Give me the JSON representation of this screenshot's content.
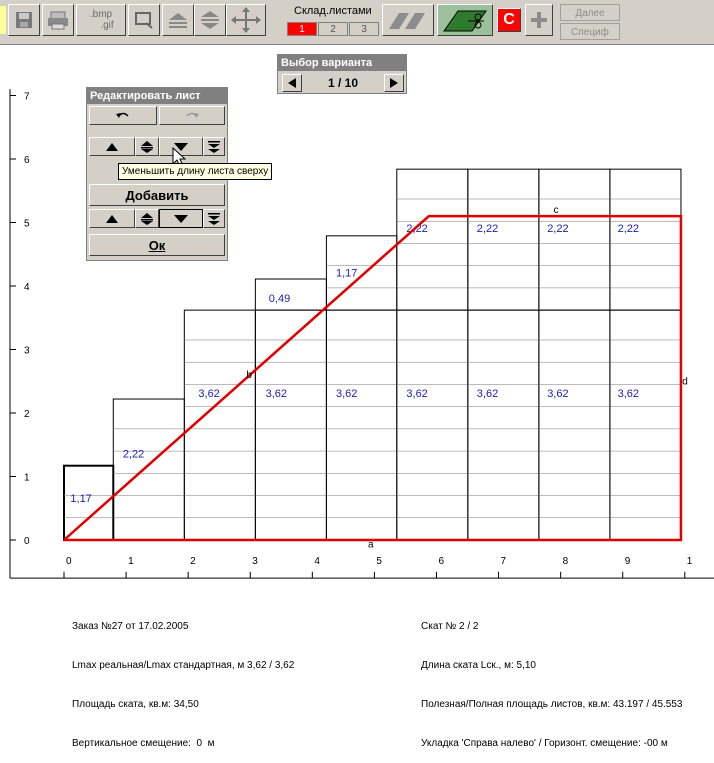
{
  "toolbar": {
    "bmp_label": ".bmp",
    "gif_label": ".gif",
    "sklad_label": "Склад.листами",
    "sklad_tabs": [
      "1",
      "2",
      "3"
    ],
    "c_label": "С",
    "next_label": "Далее",
    "spec_label": "Специф"
  },
  "variant": {
    "title": "Выбор варианта",
    "value": "1 / 10"
  },
  "edit_panel": {
    "title": "Редактировать лист",
    "add_label": "Добавить",
    "ok_label": "Ок"
  },
  "tooltip": "Уменьшить длину листа сверху",
  "chart_data": {
    "type": "roof-sheet-layout",
    "x_ticks": [
      "0",
      "1",
      "2",
      "3",
      "4",
      "5",
      "6",
      "7",
      "8",
      "9",
      "1"
    ],
    "y_ticks": [
      "0",
      "1",
      "2",
      "3",
      "4",
      "5",
      "6",
      "7"
    ],
    "sheet_columns": [
      {
        "x0": 0,
        "x1": 0.77,
        "heights": [
          1.17
        ]
      },
      {
        "x0": 0.77,
        "x1": 1.88,
        "heights": [
          2.22
        ]
      },
      {
        "x0": 1.88,
        "x1": 2.99,
        "heights": [
          3.62
        ]
      },
      {
        "x0": 2.99,
        "x1": 4.1,
        "heights": [
          3.62,
          0.49
        ]
      },
      {
        "x0": 4.1,
        "x1": 5.2,
        "heights": [
          3.62,
          1.17
        ]
      },
      {
        "x0": 5.2,
        "x1": 6.31,
        "heights": [
          3.62,
          2.22
        ]
      },
      {
        "x0": 6.31,
        "x1": 7.42,
        "heights": [
          3.62,
          2.22
        ]
      },
      {
        "x0": 7.42,
        "x1": 8.53,
        "heights": [
          3.62,
          2.22
        ]
      },
      {
        "x0": 8.53,
        "x1": 9.64,
        "heights": [
          3.62,
          2.22
        ]
      }
    ],
    "outline": [
      [
        0,
        0
      ],
      [
        5.7,
        5.1
      ],
      [
        9.64,
        5.1
      ],
      [
        9.64,
        0
      ],
      [
        0,
        0
      ]
    ],
    "point_labels": [
      "a",
      "b",
      "c",
      "d"
    ],
    "sheet_labels": [
      "1,17",
      "2,22",
      "3,62",
      "3,62",
      "3,62",
      "3,62",
      "3,62",
      "3,62",
      "3,62",
      "0,49",
      "1,17",
      "2,22",
      "2,22",
      "2,22",
      "2,22"
    ]
  },
  "footer": {
    "left": [
      "Заказ №27 от 17.02.2005",
      "Lmax реальная/Lmax стандартная, м 3,62 / 3,62",
      "Площадь ската, кв.м: 34,50",
      "Вертикальное смещение:  0  м"
    ],
    "right": [
      "Скат № 2 / 2",
      "Длина ската Lск., м: 5,10",
      "Полезная/Полная площадь листов, кв.м: 43.197 / 45.553",
      "Укладка 'Справа налево' / Горизонт. смещение: -00 м"
    ]
  }
}
